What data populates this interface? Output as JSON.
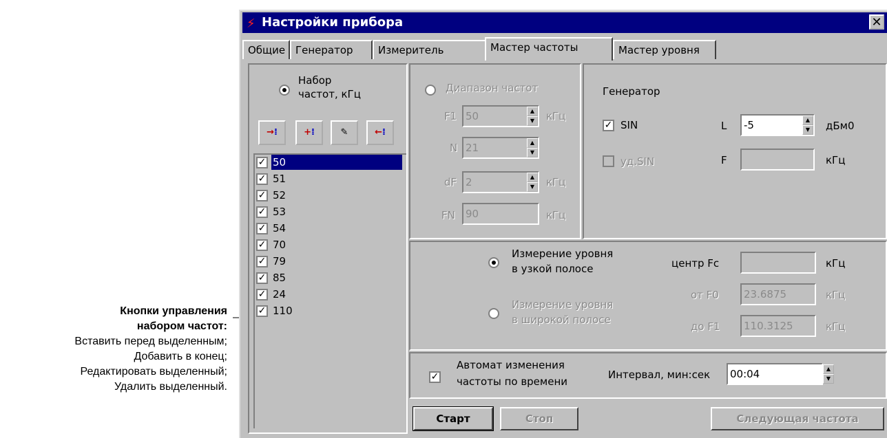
{
  "annotation": {
    "title_line1": "Кнопки управления",
    "title_line2": "набором частот:",
    "lines": [
      "Вставить перед выделенным;",
      "Добавить в конец;",
      "Редактировать выделенный;",
      "Удалить выделенный."
    ]
  },
  "window": {
    "title": "Настройки прибора",
    "close": "✕"
  },
  "tabs": [
    "Общие",
    "Генератор",
    "Измеритель",
    "Мастер частоты",
    "Мастер уровня"
  ],
  "active_tab": "Мастер частоты",
  "freq_set": {
    "label_line1": "Набор",
    "label_line2": "частот, кГц",
    "toolbar": [
      "insert-before",
      "append",
      "edit",
      "delete"
    ],
    "items": [
      "50",
      "51",
      "52",
      "53",
      "54",
      "70",
      "79",
      "85",
      "24",
      "110"
    ],
    "selected": "50"
  },
  "range": {
    "label": "Диапазон частот",
    "f1_label": "F1",
    "f1_value": "50",
    "f1_unit": "кГц",
    "n_label": "N",
    "n_value": "21",
    "df_label": "dF",
    "df_value": "2",
    "df_unit": "кГц",
    "fn_label": "FN",
    "fn_value": "90",
    "fn_unit": "кГц"
  },
  "generator": {
    "title": "Генератор",
    "sin_label": "SIN",
    "udsin_label": "уд.SIN",
    "l_label": "L",
    "l_value": "-5",
    "l_unit": "дБм0",
    "f_label": "F",
    "f_value": "",
    "f_unit": "кГц"
  },
  "measure": {
    "narrow_line1": "Измерение уровня",
    "narrow_line2": "в узкой полосе",
    "wide_line1": "Измерение уровня",
    "wide_line2": "в широкой полосе",
    "center_label": "центр Fc",
    "center_value": "",
    "center_unit": "кГц",
    "f0_label": "от F0",
    "f0_value": "23.6875",
    "f0_unit": "кГц",
    "f1_label": "до F1",
    "f1_value": "110.3125",
    "f1_unit": "кГц"
  },
  "auto": {
    "label_line1": "Автомат изменения",
    "label_line2": "частоты по времени",
    "interval_label": "Интервал, мин:сек",
    "interval_value": "00:04"
  },
  "buttons": {
    "start": "Старт",
    "stop": "Стоп",
    "next": "Следующая частота"
  },
  "colors": {
    "titlebar": "#000080",
    "face": "#c0c0c0",
    "callout": "#ffe000"
  }
}
